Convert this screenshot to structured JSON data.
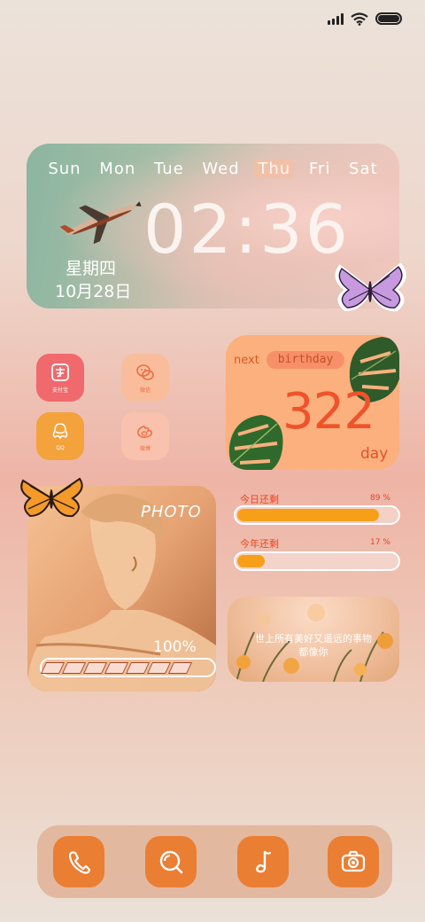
{
  "clock_widget": {
    "days": [
      "Sun",
      "Mon",
      "Tue",
      "Wed",
      "Thu",
      "Fri",
      "Sat"
    ],
    "active_day": "Thu",
    "time": "02:36",
    "weekday": "星期四",
    "date": "10月28日"
  },
  "apps": [
    {
      "label": "支付宝",
      "color": "#f0696d",
      "icon": "alipay-icon"
    },
    {
      "label": "微信",
      "color": "#f9bd9c",
      "icon": "wechat-icon"
    },
    {
      "label": "QQ",
      "color": "#f3a23c",
      "icon": "qq-icon"
    },
    {
      "label": "微博",
      "color": "#f8c2ae",
      "icon": "weibo-icon"
    }
  ],
  "birthday": {
    "prefix": "next",
    "label": "birthday",
    "count": "322",
    "unit": "day"
  },
  "photo_widget": {
    "label": "PHOTO",
    "percent_text": "100%",
    "progress": 1.0
  },
  "day_progress": {
    "label": "今日还剩",
    "percent_text": "89 %",
    "value": 0.89
  },
  "year_progress": {
    "label": "今年还剩",
    "percent_text": "17 %",
    "value": 0.17
  },
  "quote": {
    "line1": "世上所有美好又遥远的事物",
    "line2": "都像你"
  },
  "dock": [
    "phone-icon",
    "search-icon",
    "music-icon",
    "camera-icon"
  ],
  "colors": {
    "accent": "#ea7e33",
    "progress": "#f89f1a",
    "text_red": "#e8461f"
  }
}
